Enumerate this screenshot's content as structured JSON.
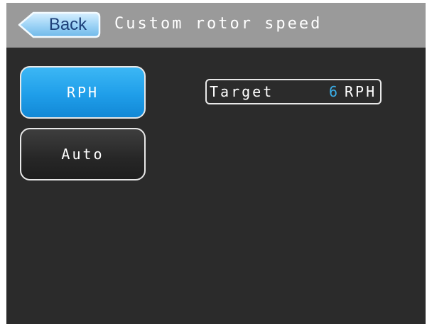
{
  "header": {
    "back_label": "Back",
    "title": "Custom rotor speed"
  },
  "modes": {
    "rph_label": "RPH",
    "auto_label": "Auto",
    "selected": "RPH"
  },
  "target": {
    "label": "Target",
    "value": "6",
    "unit": "RPH"
  },
  "colors": {
    "header_bg": "#9a9a9a",
    "screen_bg": "#2b2b2b",
    "selected_button": "#1f9ee9",
    "value_accent": "#3aaee8",
    "back_label": "#1d3f78"
  }
}
